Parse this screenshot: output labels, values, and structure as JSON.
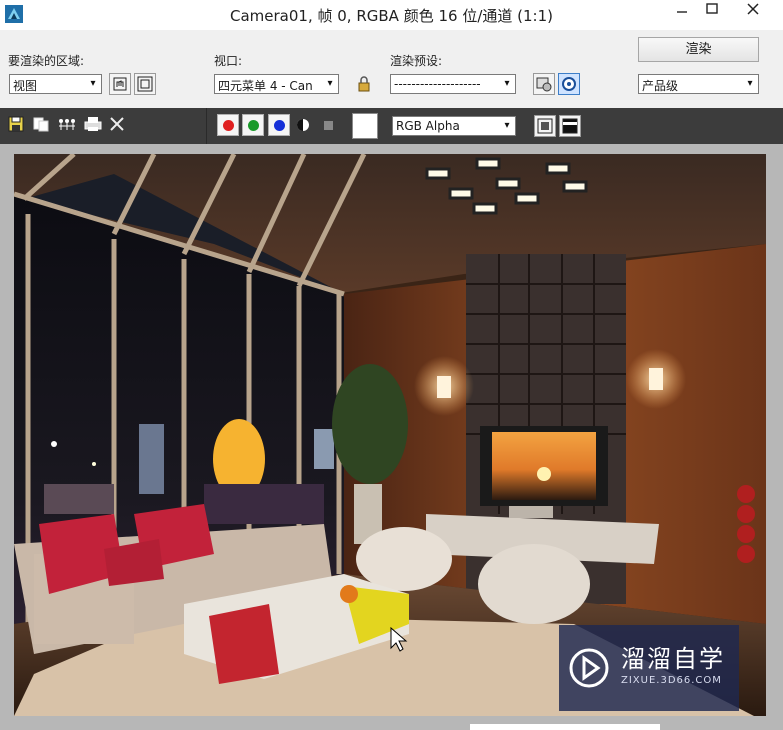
{
  "window": {
    "title": "Camera01, 帧 0, RGBA 颜色 16 位/通道 (1:1)",
    "icon": "3dsmax-app-icon",
    "controls": [
      "minimize-icon",
      "maximize-icon",
      "close-icon"
    ]
  },
  "toolbar": {
    "area_label": "要渲染的区域:",
    "area_value": "视图",
    "viewport_label": "视口:",
    "viewport_value": "四元菜单 4 - Can",
    "preset_label": "渲染预设:",
    "preset_value": "--------------------",
    "render_button": "渲染",
    "quality_value": "产品级"
  },
  "toolbar2": {
    "icons": [
      "save-icon",
      "copy-icon",
      "clone-icon",
      "print-icon",
      "clear-icon"
    ],
    "channels": [
      {
        "name": "red-channel",
        "color": "#e02020"
      },
      {
        "name": "green-channel",
        "color": "#1a9a2a"
      },
      {
        "name": "blue-channel",
        "color": "#1530d8"
      }
    ],
    "channel_display_value": "RGB Alpha"
  },
  "watermark": {
    "title": "溜溜自学",
    "subtitle": "ZIXUE.3D66.COM"
  },
  "colors": {
    "accent": "#3d7ec8",
    "toolbar_dark": "#3c3c3c"
  }
}
